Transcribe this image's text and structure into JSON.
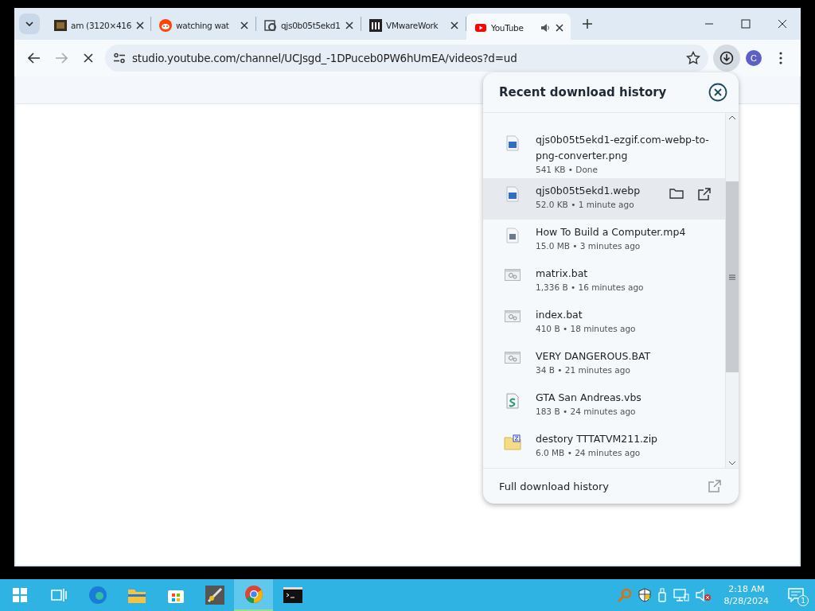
{
  "tabs": [
    {
      "title": "am (3120×416",
      "kind": "image",
      "selected": false,
      "audio": false
    },
    {
      "title": "watching wat",
      "kind": "reddit",
      "selected": false,
      "audio": false
    },
    {
      "title": "qjs0b05t5ekd1",
      "kind": "script",
      "selected": false,
      "audio": false
    },
    {
      "title": "VMwareWork",
      "kind": "vmware",
      "selected": false,
      "audio": false
    },
    {
      "title": "YouTube",
      "kind": "youtube",
      "selected": true,
      "audio": true
    }
  ],
  "address_bar": {
    "url": "studio.youtube.com/channel/UCJsgd_-1DPuceb0PW6hUmEA/videos?d=ud"
  },
  "profile": {
    "initial": "C"
  },
  "downloads": {
    "title": "Recent download history",
    "items": [
      {
        "name": "qjs0b05t5ekd1-ezgif.com-webp-to-png-converter.png",
        "details": "541 KB • Done",
        "kind": "image",
        "selected": false
      },
      {
        "name": "qjs0b05t5ekd1.webp",
        "details": "52.0 KB • 1 minute ago",
        "kind": "image",
        "selected": true
      },
      {
        "name": "How To Build a Computer.mp4",
        "details": "15.0 MB • 3 minutes ago",
        "kind": "video",
        "selected": false
      },
      {
        "name": "matrix.bat",
        "details": "1,336 B • 16 minutes ago",
        "kind": "batch",
        "selected": false
      },
      {
        "name": "index.bat",
        "details": "410 B • 18 minutes ago",
        "kind": "batch",
        "selected": false
      },
      {
        "name": "VERY DANGEROUS.BAT",
        "details": "34 B • 21 minutes ago",
        "kind": "batch",
        "selected": false
      },
      {
        "name": "GTA San Andreas.vbs",
        "details": "183 B • 24 minutes ago",
        "kind": "script",
        "selected": false
      },
      {
        "name": "destory TTTATVM211.zip",
        "details": "6.0 MB • 24 minutes ago",
        "kind": "zip",
        "selected": false
      }
    ],
    "footer": "Full download history"
  },
  "taskbar": {
    "apps": [
      {
        "kind": "start",
        "active": false
      },
      {
        "kind": "taskview",
        "active": false
      },
      {
        "kind": "edge",
        "active": false
      },
      {
        "kind": "explorer",
        "active": false
      },
      {
        "kind": "store",
        "active": false
      },
      {
        "kind": "app",
        "active": false
      },
      {
        "kind": "chrome",
        "active": true
      },
      {
        "kind": "terminal",
        "active": false
      }
    ],
    "clock": {
      "time": "2:18 AM",
      "date": "8/28/2024"
    },
    "notifications": "1"
  }
}
